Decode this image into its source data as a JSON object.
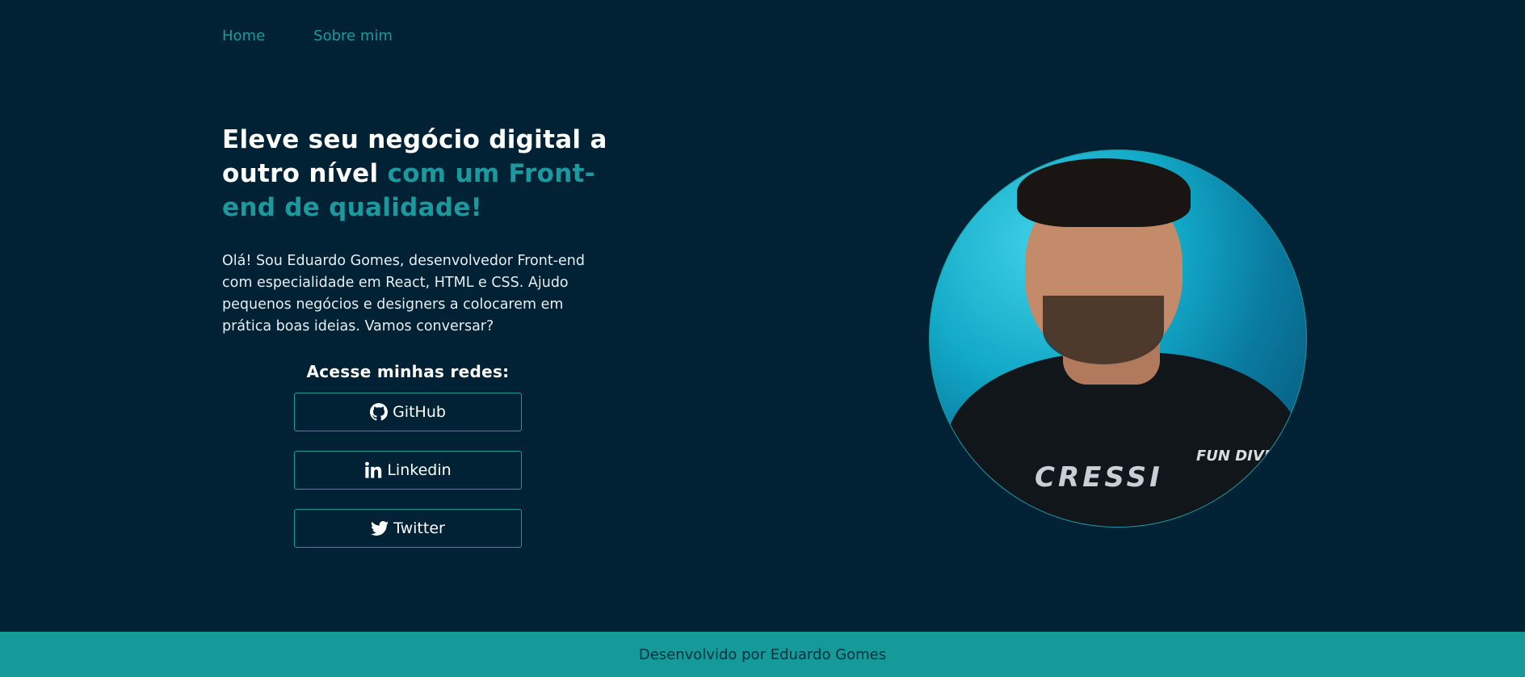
{
  "nav": {
    "items": [
      {
        "label": "Home"
      },
      {
        "label": "Sobre mim"
      }
    ]
  },
  "hero": {
    "headline_part1": "Eleve seu negócio digital a outro nível ",
    "headline_accent": "com um Front-end de qualidade!",
    "intro": "Olá! Sou Eduardo Gomes, desenvolvedor Front-end com especialidade em React, HTML e CSS. Ajudo pequenos negócios e designers a colocarem em prática boas ideias. Vamos conversar?"
  },
  "social": {
    "title": "Acesse minhas redes:",
    "buttons": [
      {
        "label": "GitHub",
        "icon": "github-icon"
      },
      {
        "label": "Linkedin",
        "icon": "linkedin-icon"
      },
      {
        "label": "Twitter",
        "icon": "twitter-icon"
      }
    ]
  },
  "photo": {
    "shirt_brand": "CRESSI",
    "shirt_tag": "FUN DIVE"
  },
  "footer": {
    "text": "Desenvolvido por Eduardo Gomes"
  },
  "colors": {
    "background": "#002234",
    "accent": "#1a9a9e",
    "footer": "#169999"
  }
}
